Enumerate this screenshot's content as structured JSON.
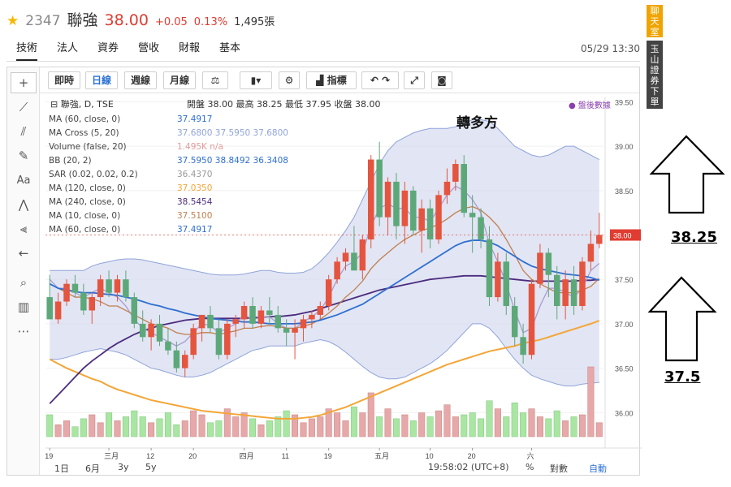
{
  "header": {
    "code": "2347",
    "name": "聯強",
    "price": "38.00",
    "change": "+0.05",
    "change_pct": "0.13%",
    "volume": "1,495張"
  },
  "nav_tabs": [
    "技術",
    "法人",
    "資券",
    "營收",
    "財報",
    "基本"
  ],
  "datetime": "05/29 13:30",
  "side_buttons": {
    "chat": "聊天室",
    "ad": "玉山證券下單"
  },
  "toolbar": {
    "buttons": [
      "即時",
      "日線",
      "週線",
      "月線"
    ],
    "indicator": "指標"
  },
  "bottom_bar": {
    "ranges": [
      "1日",
      "6月",
      "3y",
      "5y"
    ],
    "time": "19:58:02 (UTC+8)",
    "percent": "%",
    "log": "對數",
    "auto": "自動"
  },
  "colors": {
    "up": "#e5543e",
    "down": "#5ca879",
    "ma10": "#c08050",
    "ma60": "#2e6fd0",
    "ma120": "#f3a638",
    "ma240": "#4b2c7e",
    "bb_line": "#8fa4d9",
    "bb_fill": "#d8dcf0",
    "kd": "#a89cd0"
  },
  "chart_data": {
    "type": "candlestick",
    "symbol": "聯強",
    "interval": "D",
    "exchange": "TSE",
    "ohlc_legend": {
      "open": "38.00",
      "high": "38.25",
      "low": "37.95",
      "close": "38.00"
    },
    "after_hours": "盤後數據",
    "indicators": [
      {
        "label": "MA (60, close, 0)",
        "values": [
          "37.4917"
        ],
        "color": "#2e6fd0"
      },
      {
        "label": "MA Cross (5, 20)",
        "values": [
          "37.6800",
          "37.5950",
          "37.6800"
        ],
        "color": "#8fa4d9"
      },
      {
        "label": "Volume (false, 20)",
        "values": [
          "1.495K",
          "n/a"
        ],
        "color": "#e59a9a"
      },
      {
        "label": "BB (20, 2)",
        "values": [
          "37.5950",
          "38.8492",
          "36.3408"
        ],
        "color": "#2e6fd0"
      },
      {
        "label": "SAR (0.02, 0.02, 0.2)",
        "values": [
          "36.4370"
        ],
        "color": "#999999"
      },
      {
        "label": "MA (120, close, 0)",
        "values": [
          "37.0350"
        ],
        "color": "#f3a638"
      },
      {
        "label": "MA (240, close, 0)",
        "values": [
          "38.5454"
        ],
        "color": "#4b2c7e"
      },
      {
        "label": "MA (10, close, 0)",
        "values": [
          "37.5100"
        ],
        "color": "#c08050"
      },
      {
        "label": "MA (60, close, 0)",
        "values": [
          "37.4917"
        ],
        "color": "#2e6fd0"
      }
    ],
    "y_ticks": [
      "39.50",
      "39.00",
      "38.50",
      "38.00",
      "37.50",
      "37.00",
      "36.50",
      "36.00"
    ],
    "y_range": [
      35.6,
      39.55
    ],
    "last_price_label": "38.00",
    "x_ticks": [
      "19",
      "三月",
      "12",
      "20",
      "四月",
      "11",
      "19",
      "五月",
      "10",
      "20",
      "六"
    ],
    "x_tick_index": [
      0,
      7,
      12,
      17,
      23,
      28,
      33,
      39,
      45,
      50,
      57
    ],
    "annotation_title": "轉多方",
    "candles": [
      [
        37.3,
        37.55,
        37.1,
        37.05
      ],
      [
        37.05,
        37.35,
        37.0,
        37.25
      ],
      [
        37.25,
        37.5,
        37.2,
        37.45
      ],
      [
        37.45,
        37.55,
        37.3,
        37.35
      ],
      [
        37.35,
        37.45,
        37.1,
        37.15
      ],
      [
        37.15,
        37.35,
        37.0,
        37.3
      ],
      [
        37.3,
        37.55,
        37.2,
        37.5
      ],
      [
        37.5,
        37.6,
        37.3,
        37.35
      ],
      [
        37.35,
        37.55,
        37.25,
        37.5
      ],
      [
        37.5,
        37.6,
        37.25,
        37.3
      ],
      [
        37.3,
        37.35,
        36.95,
        37.0
      ],
      [
        37.0,
        37.15,
        36.8,
        36.85
      ],
      [
        36.85,
        37.05,
        36.7,
        37.0
      ],
      [
        37.0,
        37.1,
        36.75,
        36.8
      ],
      [
        36.8,
        36.95,
        36.65,
        36.7
      ],
      [
        36.7,
        36.8,
        36.45,
        36.5
      ],
      [
        36.5,
        36.7,
        36.4,
        36.65
      ],
      [
        36.65,
        37.0,
        36.6,
        36.95
      ],
      [
        36.95,
        37.1,
        36.8,
        37.1
      ],
      [
        37.1,
        37.2,
        36.9,
        36.95
      ],
      [
        36.95,
        37.05,
        36.6,
        36.65
      ],
      [
        36.65,
        37.05,
        36.6,
        37.0
      ],
      [
        37.0,
        37.1,
        36.85,
        37.05
      ],
      [
        37.05,
        37.25,
        36.95,
        37.2
      ],
      [
        37.2,
        37.3,
        36.95,
        37.0
      ],
      [
        37.0,
        37.2,
        36.95,
        37.15
      ],
      [
        37.15,
        37.3,
        37.0,
        37.1
      ],
      [
        37.1,
        37.2,
        36.9,
        36.95
      ],
      [
        36.95,
        37.05,
        36.75,
        36.9
      ],
      [
        36.9,
        37.05,
        36.6,
        36.95
      ],
      [
        36.95,
        37.1,
        36.8,
        37.05
      ],
      [
        37.05,
        37.15,
        36.95,
        37.1
      ],
      [
        37.1,
        37.25,
        37.05,
        37.2
      ],
      [
        37.2,
        37.55,
        37.15,
        37.5
      ],
      [
        37.5,
        37.75,
        37.45,
        37.7
      ],
      [
        37.7,
        37.85,
        37.6,
        37.8
      ],
      [
        37.8,
        38.1,
        37.7,
        37.6
      ],
      [
        37.6,
        38.0,
        37.5,
        37.95
      ],
      [
        37.95,
        38.9,
        37.85,
        38.85
      ],
      [
        38.85,
        39.05,
        38.1,
        38.2
      ],
      [
        38.2,
        38.65,
        38.0,
        38.6
      ],
      [
        38.6,
        38.7,
        37.95,
        38.1
      ],
      [
        38.1,
        38.6,
        37.9,
        38.5
      ],
      [
        38.5,
        38.55,
        38.0,
        38.05
      ],
      [
        38.05,
        38.4,
        37.8,
        38.3
      ],
      [
        38.3,
        38.4,
        37.85,
        37.95
      ],
      [
        37.95,
        38.5,
        37.9,
        38.45
      ],
      [
        38.45,
        38.75,
        38.35,
        38.6
      ],
      [
        38.6,
        38.85,
        38.5,
        38.8
      ],
      [
        38.8,
        38.9,
        38.2,
        38.25
      ],
      [
        38.25,
        38.45,
        37.8,
        38.2
      ],
      [
        38.2,
        38.3,
        37.85,
        37.95
      ],
      [
        37.95,
        38.1,
        37.2,
        37.3
      ],
      [
        37.3,
        37.8,
        37.25,
        37.7
      ],
      [
        37.7,
        37.8,
        37.1,
        37.2
      ],
      [
        37.2,
        37.3,
        36.75,
        36.85
      ],
      [
        36.85,
        37.0,
        36.55,
        36.65
      ],
      [
        36.65,
        37.5,
        36.6,
        37.45
      ],
      [
        37.45,
        37.9,
        37.4,
        37.8
      ],
      [
        37.8,
        37.85,
        37.3,
        37.55
      ],
      [
        37.55,
        37.65,
        37.05,
        37.2
      ],
      [
        37.2,
        37.6,
        37.05,
        37.5
      ],
      [
        37.5,
        37.65,
        37.1,
        37.2
      ],
      [
        37.2,
        37.75,
        37.15,
        37.7
      ],
      [
        37.7,
        38.05,
        37.6,
        37.9
      ],
      [
        37.9,
        38.25,
        37.85,
        38.0
      ]
    ],
    "volumes": [
      1.1,
      0.6,
      0.8,
      0.5,
      0.9,
      1.1,
      0.7,
      1.2,
      0.8,
      1.0,
      1.3,
      1.0,
      0.7,
      0.9,
      1.2,
      0.6,
      0.8,
      1.3,
      1.1,
      0.7,
      0.8,
      1.4,
      1.0,
      1.2,
      0.9,
      0.6,
      0.8,
      1.0,
      1.3,
      1.1,
      0.7,
      0.9,
      1.0,
      1.4,
      1.2,
      0.8,
      1.5,
      1.2,
      2.2,
      1.0,
      1.4,
      0.9,
      1.1,
      0.8,
      1.2,
      1.0,
      1.3,
      1.6,
      1.0,
      1.1,
      1.2,
      0.9,
      1.8,
      1.4,
      1.0,
      1.7,
      1.2,
      1.4,
      1.0,
      0.9,
      1.3,
      0.8,
      1.0,
      1.1,
      3.5,
      0.7
    ],
    "ma10": [
      37.45,
      37.4,
      37.35,
      37.3,
      37.3,
      37.28,
      37.25,
      37.2,
      37.2,
      37.15,
      37.1,
      37.05,
      37.0,
      36.98,
      36.95,
      36.9,
      36.88,
      36.88,
      36.9,
      36.9,
      36.88,
      36.9,
      36.92,
      36.95,
      36.95,
      36.97,
      36.98,
      36.97,
      36.95,
      36.95,
      36.97,
      37.0,
      37.05,
      37.12,
      37.2,
      37.3,
      37.38,
      37.48,
      37.62,
      37.72,
      37.8,
      37.88,
      37.95,
      38.0,
      38.05,
      38.08,
      38.12,
      38.18,
      38.25,
      38.3,
      38.32,
      38.28,
      38.2,
      38.1,
      37.95,
      37.78,
      37.6,
      37.5,
      37.45,
      37.4,
      37.35,
      37.35,
      37.35,
      37.38,
      37.42,
      37.51
    ],
    "ma60": [
      37.45,
      37.4,
      37.38,
      37.36,
      37.35,
      37.35,
      37.34,
      37.33,
      37.32,
      37.3,
      37.28,
      37.25,
      37.22,
      37.2,
      37.17,
      37.15,
      37.12,
      37.1,
      37.08,
      37.06,
      37.05,
      37.04,
      37.03,
      37.02,
      37.02,
      37.01,
      37.0,
      37.0,
      37.0,
      37.0,
      37.01,
      37.02,
      37.04,
      37.07,
      37.1,
      37.14,
      37.18,
      37.22,
      37.28,
      37.34,
      37.4,
      37.46,
      37.52,
      37.58,
      37.64,
      37.7,
      37.76,
      37.82,
      37.88,
      37.92,
      37.94,
      37.94,
      37.92,
      37.88,
      37.82,
      37.76,
      37.7,
      37.65,
      37.62,
      37.6,
      37.58,
      37.56,
      37.55,
      37.54,
      37.52,
      37.49
    ],
    "ma120": [
      36.6,
      36.55,
      36.5,
      36.46,
      36.42,
      36.38,
      36.35,
      36.3,
      36.26,
      36.23,
      36.2,
      36.17,
      36.14,
      36.12,
      36.1,
      36.08,
      36.06,
      36.04,
      36.02,
      36.01,
      36.0,
      35.99,
      35.98,
      35.97,
      35.96,
      35.95,
      35.94,
      35.93,
      35.93,
      35.93,
      35.94,
      35.95,
      35.97,
      36.0,
      36.03,
      36.06,
      36.1,
      36.14,
      36.18,
      36.22,
      36.26,
      36.3,
      36.34,
      36.38,
      36.42,
      36.46,
      36.5,
      36.54,
      36.57,
      36.6,
      36.63,
      36.66,
      36.69,
      36.71,
      36.73,
      36.75,
      36.78,
      36.8,
      36.82,
      36.85,
      36.88,
      36.91,
      36.94,
      36.97,
      37.0,
      37.035
    ],
    "ma240": [
      36.1,
      36.2,
      36.3,
      36.4,
      36.5,
      36.58,
      36.65,
      36.72,
      36.78,
      36.83,
      36.88,
      36.92,
      36.95,
      36.98,
      37.0,
      37.02,
      37.04,
      37.05,
      37.06,
      37.06,
      37.06,
      37.06,
      37.06,
      37.06,
      37.07,
      37.07,
      37.08,
      37.08,
      37.09,
      37.1,
      37.12,
      37.14,
      37.17,
      37.2,
      37.23,
      37.26,
      37.29,
      37.32,
      37.35,
      37.38,
      37.4,
      37.42,
      37.44,
      37.46,
      37.48,
      37.5,
      37.51,
      37.52,
      37.53,
      37.54,
      37.54,
      37.54,
      37.53,
      37.52,
      37.51,
      37.5,
      37.49,
      37.48,
      37.48,
      37.48,
      37.48,
      37.48,
      37.48,
      37.49,
      37.49,
      37.5
    ],
    "bb_upper": [
      37.6,
      37.6,
      37.6,
      37.6,
      37.6,
      37.65,
      37.68,
      37.7,
      37.72,
      37.73,
      37.73,
      37.72,
      37.7,
      37.68,
      37.66,
      37.64,
      37.62,
      37.6,
      37.58,
      37.56,
      37.55,
      37.55,
      37.55,
      37.56,
      37.58,
      37.6,
      37.6,
      37.58,
      37.57,
      37.57,
      37.58,
      37.62,
      37.7,
      37.8,
      37.92,
      38.05,
      38.2,
      38.4,
      38.6,
      38.8,
      38.95,
      39.05,
      39.1,
      39.15,
      39.18,
      39.2,
      39.2,
      39.2,
      39.22,
      39.25,
      39.3,
      39.3,
      39.28,
      39.2,
      39.1,
      39.0,
      38.95,
      38.9,
      38.88,
      38.9,
      38.95,
      39.0,
      39.0,
      38.95,
      38.9,
      38.85
    ],
    "bb_lower": [
      36.6,
      36.6,
      36.62,
      36.65,
      36.68,
      36.7,
      36.72,
      36.7,
      36.68,
      36.65,
      36.6,
      36.55,
      36.5,
      36.48,
      36.45,
      36.42,
      36.4,
      36.4,
      36.42,
      36.45,
      36.5,
      36.55,
      36.6,
      36.65,
      36.7,
      36.72,
      36.75,
      36.75,
      36.75,
      36.75,
      36.78,
      36.8,
      36.82,
      36.8,
      36.75,
      36.68,
      36.6,
      36.52,
      36.45,
      36.4,
      36.38,
      36.38,
      36.4,
      36.45,
      36.5,
      36.55,
      36.62,
      36.7,
      36.8,
      36.9,
      37.0,
      37.0,
      36.95,
      36.85,
      36.72,
      36.6,
      36.5,
      36.42,
      36.38,
      36.35,
      36.32,
      36.3,
      36.3,
      36.32,
      36.33,
      36.34
    ],
    "bb_mid": [
      37.1,
      37.1,
      37.11,
      37.12,
      37.14,
      37.17,
      37.2,
      37.2,
      37.2,
      37.19,
      37.16,
      37.13,
      37.1,
      37.08,
      37.05,
      37.03,
      37.01,
      37.0,
      37.0,
      37.0,
      37.02,
      37.05,
      37.07,
      37.1,
      37.14,
      37.16,
      37.17,
      37.16,
      37.16,
      37.16,
      37.18,
      37.21,
      37.26,
      37.3,
      37.34,
      37.37,
      37.4,
      37.46,
      37.52,
      37.6,
      37.66,
      37.72,
      37.75,
      37.8,
      37.84,
      37.88,
      37.91,
      37.95,
      38.01,
      38.08,
      38.15,
      38.15,
      38.12,
      38.02,
      37.91,
      37.8,
      37.72,
      37.66,
      37.63,
      37.62,
      37.63,
      37.65,
      37.65,
      37.63,
      37.61,
      37.595
    ],
    "kd_line": [
      37.5,
      37.4,
      37.4,
      37.35,
      37.3,
      37.35,
      37.4,
      37.35,
      37.3,
      37.2,
      37.05,
      36.95,
      36.9,
      36.85,
      36.8,
      36.75,
      36.8,
      36.9,
      37.0,
      36.98,
      36.9,
      36.95,
      37.0,
      37.1,
      37.05,
      37.07,
      37.08,
      37.0,
      36.95,
      36.95,
      37.02,
      37.08,
      37.15,
      37.3,
      37.5,
      37.65,
      37.7,
      37.8,
      38.1,
      38.3,
      38.35,
      38.3,
      38.3,
      38.2,
      38.2,
      38.15,
      38.3,
      38.45,
      38.55,
      38.5,
      38.4,
      38.25,
      37.9,
      37.7,
      37.45,
      37.15,
      36.9,
      36.95,
      37.2,
      37.4,
      37.4,
      37.35,
      37.3,
      37.4,
      37.6,
      37.68
    ]
  }
}
